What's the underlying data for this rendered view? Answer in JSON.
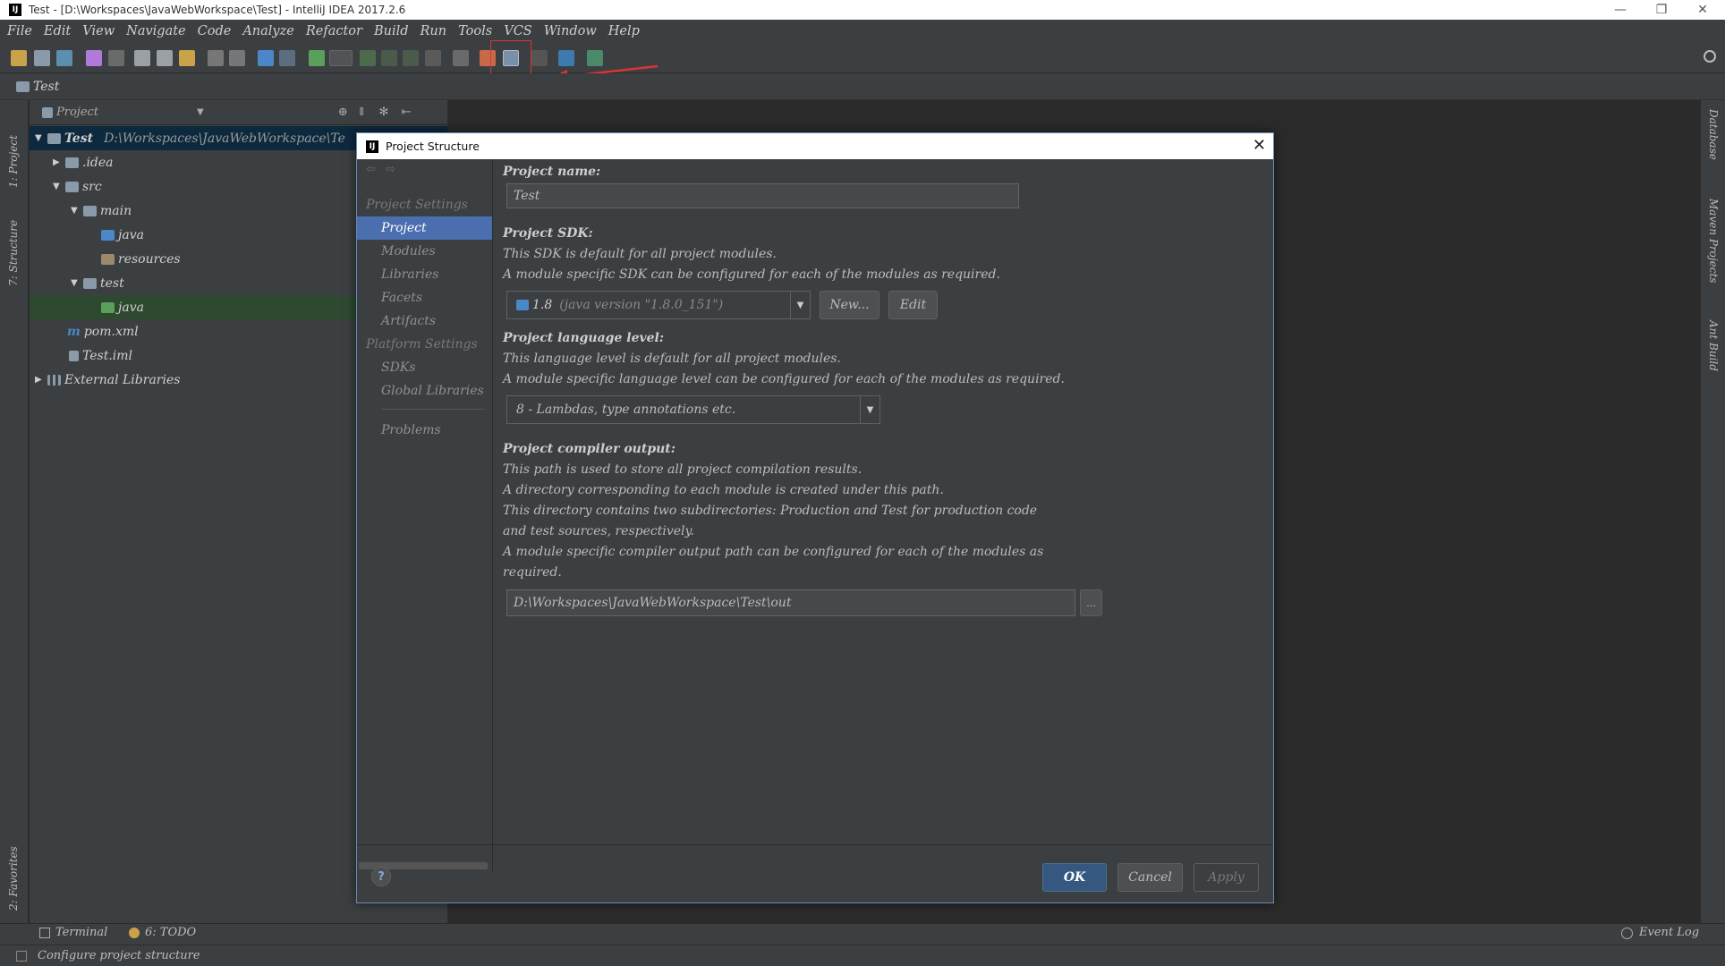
{
  "window": {
    "title": "Test - [D:\\Workspaces\\JavaWebWorkspace\\Test] - IntelliJ IDEA 2017.2.6",
    "logo": "IJ"
  },
  "menu": [
    "File",
    "Edit",
    "View",
    "Navigate",
    "Code",
    "Analyze",
    "Refactor",
    "Build",
    "Run",
    "Tools",
    "VCS",
    "Window",
    "Help"
  ],
  "breadcrumb": "Test",
  "left_strip": {
    "project": "1: Project",
    "structure": "7: Structure",
    "favorites": "2: Favorites"
  },
  "right_strip": {
    "database": "Database",
    "maven": "Maven Projects",
    "ant": "Ant Build"
  },
  "project_panel": {
    "header": "Project",
    "tree": [
      {
        "label": "Test",
        "path": "D:\\Workspaces\\JavaWebWorkspace\\Te",
        "level": 0,
        "expanded": true
      },
      {
        "label": ".idea",
        "level": 1,
        "expanded": false
      },
      {
        "label": "src",
        "level": 1,
        "expanded": true
      },
      {
        "label": "main",
        "level": 2,
        "expanded": true
      },
      {
        "label": "java",
        "level": 3
      },
      {
        "label": "resources",
        "level": 3
      },
      {
        "label": "test",
        "level": 2,
        "expanded": true
      },
      {
        "label": "java",
        "level": 3
      },
      {
        "label": "pom.xml",
        "level": 1
      },
      {
        "label": "Test.iml",
        "level": 1
      },
      {
        "label": "External Libraries",
        "level": 0,
        "expanded": false
      }
    ]
  },
  "bottom_bar": {
    "terminal": "Terminal",
    "todo": "6: TODO",
    "event_log": "Event Log"
  },
  "status_bar": {
    "text": "Configure project structure"
  },
  "dialog": {
    "title": "Project Structure",
    "logo": "IJ",
    "close": "✕",
    "nav": {
      "project_settings_header": "Project Settings",
      "project": "Project",
      "modules": "Modules",
      "libraries": "Libraries",
      "facets": "Facets",
      "artifacts": "Artifacts",
      "platform_settings_header": "Platform Settings",
      "sdks": "SDKs",
      "global_libraries": "Global Libraries",
      "problems": "Problems"
    },
    "project_name": {
      "label": "Project name:",
      "value": "Test"
    },
    "project_sdk": {
      "label": "Project SDK:",
      "desc1": "This SDK is default for all project modules.",
      "desc2": "A module specific SDK can be configured for each of the modules as required.",
      "version": "1.8",
      "detail": "(java version \"1.8.0_151\")",
      "new_button": "New...",
      "edit_button": "Edit"
    },
    "language_level": {
      "label": "Project language level:",
      "desc1": "This language level is default for all project modules.",
      "desc2": "A module specific language level can be configured for each of the modules as required.",
      "value": "8 - Lambdas, type annotations etc."
    },
    "compiler_output": {
      "label": "Project compiler output:",
      "desc1": "This path is used to store all project compilation results.",
      "desc2": "A directory corresponding to each module is created under this path.",
      "desc3": "This directory contains two subdirectories: Production and Test for production code",
      "desc4": "and test sources, respectively.",
      "desc5": "A module specific compiler output path can be configured for each of the modules as",
      "desc6": "required.",
      "path": "D:\\Workspaces\\JavaWebWorkspace\\Test\\out",
      "browse": "..."
    },
    "buttons": {
      "help": "?",
      "ok": "OK",
      "cancel": "Cancel",
      "apply": "Apply"
    }
  },
  "colors": {
    "accent": "#4b6eaf",
    "bg": "#3c3f41",
    "editor": "#2b2b2b",
    "annotation": "#dd3333"
  }
}
